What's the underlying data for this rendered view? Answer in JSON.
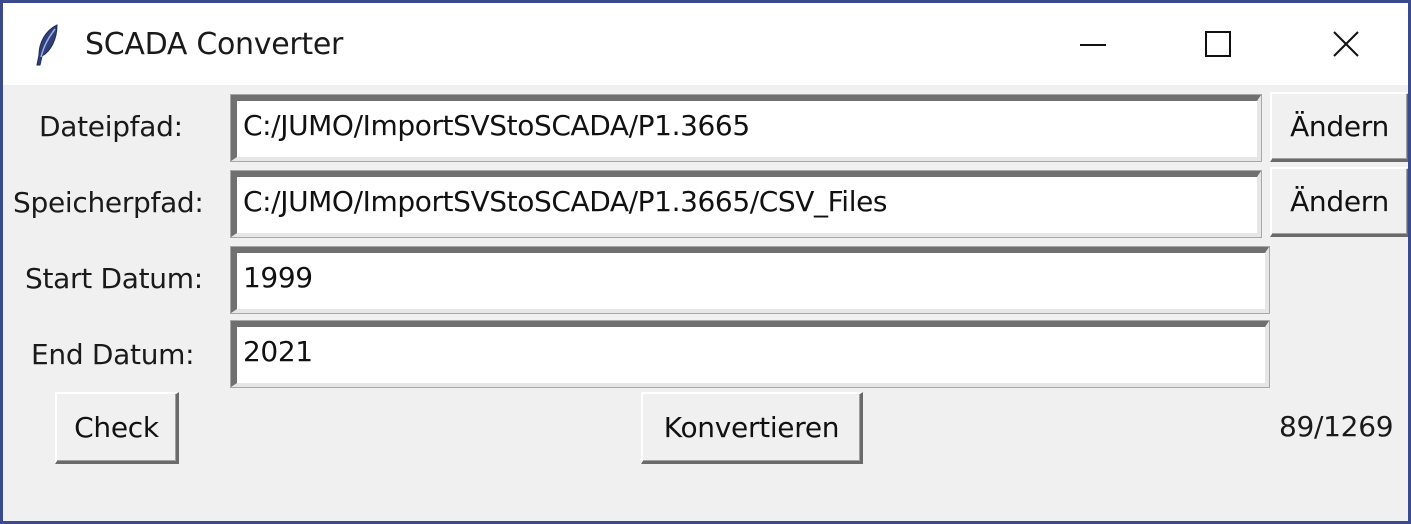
{
  "window": {
    "title": "SCADA Converter",
    "controls": {
      "minimize": "minimize",
      "maximize": "maximize",
      "close": "close"
    }
  },
  "form": {
    "source_path": {
      "label": "Dateipfad:",
      "value": "C:/JUMO/ImportSVStoSCADA/P1.3665",
      "button": "Ändern"
    },
    "save_path": {
      "label": "Speicherpfad:",
      "value": "C:/JUMO/ImportSVStoSCADA/P1.3665/CSV_Files",
      "button": "Ändern"
    },
    "start_date": {
      "label": "Start Datum:",
      "value": "1999"
    },
    "end_date": {
      "label": "End Datum:",
      "value": "2021"
    }
  },
  "actions": {
    "check": "Check",
    "convert": "Konvertieren"
  },
  "progress": {
    "text": "89/1269",
    "current": 89,
    "total": 1269
  },
  "colors": {
    "window_border": "#3a4a8c",
    "background": "#f0f0f0",
    "titlebar": "#ffffff"
  },
  "icons": {
    "app": "feather-icon",
    "minimize": "minimize-icon",
    "maximize": "maximize-icon",
    "close": "close-icon"
  }
}
